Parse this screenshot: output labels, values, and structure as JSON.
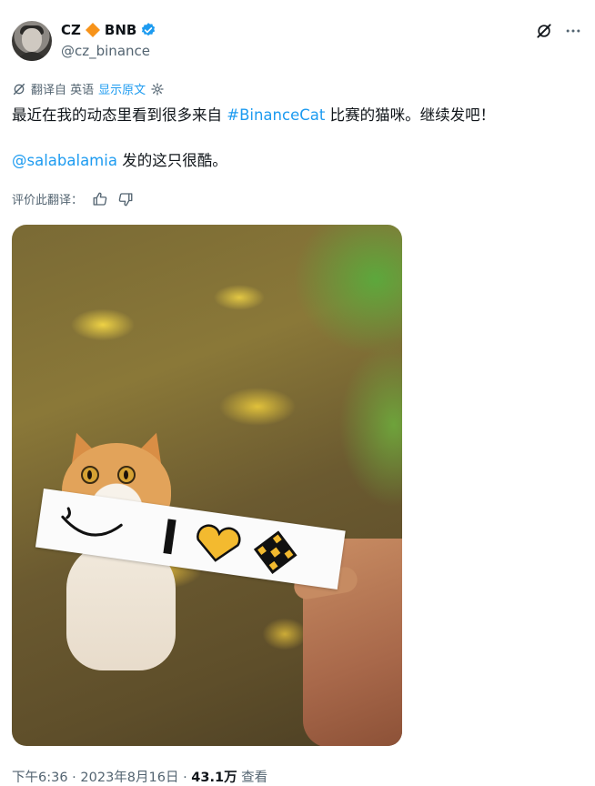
{
  "author": {
    "name": "CZ",
    "name_suffix": "BNB",
    "handle": "@cz_binance",
    "verified": true,
    "accent_color": "#1d9bf0",
    "diamond_color": "#f7931a"
  },
  "header_icons": [
    "grok-icon",
    "more-icon"
  ],
  "translation": {
    "label": "翻译自 英语",
    "show_original": "显示原文"
  },
  "tweet": {
    "line1_before": "最近在我的动态里看到很多来自 ",
    "hashtag": "#BinanceCat",
    "line1_after": " 比赛的猫咪。继续发吧！",
    "mention": "@salabalamia",
    "line2_after": " 发的这只很酷。"
  },
  "rate_translation": {
    "label": "评价此翻译："
  },
  "footer": {
    "time": "下午6:36",
    "sep1": " · ",
    "date": "2023年8月16日",
    "sep2": " · ",
    "views_count": "43.1万",
    "views_label": " 查看"
  }
}
